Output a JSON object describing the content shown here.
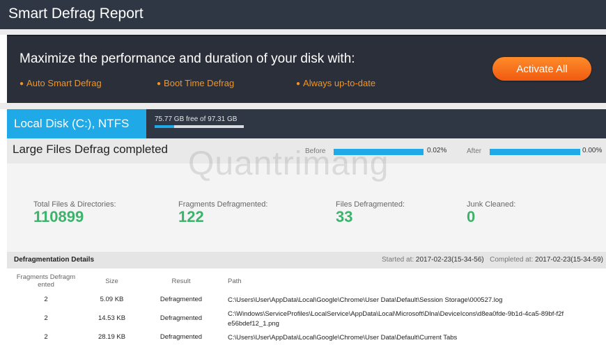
{
  "window": {
    "title": "Smart Defrag Report"
  },
  "promo": {
    "headline": "Maximize the performance and duration of your disk with:",
    "features": [
      "Auto Smart Defrag",
      "Boot Time Defrag",
      "Always up-to-date"
    ],
    "activate_label": "Activate All"
  },
  "disk": {
    "name": "Local Disk (C:), NTFS",
    "free_text": "75.77 GB free of 97.31 GB",
    "used_fraction": 0.22
  },
  "status": {
    "text": "Large Files Defrag completed",
    "before_label": "Before",
    "before_pct": "0.02%",
    "before_fraction": 0.0002,
    "after_label": "After",
    "after_pct": "0.00%",
    "after_fraction": 0.0
  },
  "stats": [
    {
      "label": "Total Files & Directories:",
      "value": "110899"
    },
    {
      "label": "Fragments Defragmented:",
      "value": "122"
    },
    {
      "label": "Files Defragmented:",
      "value": "33"
    },
    {
      "label": "Junk Cleaned:",
      "value": "0"
    }
  ],
  "watermark": "Quantrimang",
  "details": {
    "title": "Defragmentation Details",
    "started_label": "Started at:",
    "started_value": "2017-02-23(15-34-56)",
    "completed_label": "Completed at:",
    "completed_value": "2017-02-23(15-34-59)",
    "columns": [
      "Fragments Defragm ented",
      "Size",
      "Result",
      "Path"
    ],
    "rows": [
      {
        "fragments": "2",
        "size": "5.09 KB",
        "result": "Defragmented",
        "path": "C:\\Users\\User\\AppData\\Local\\Google\\Chrome\\User Data\\Default\\Session Storage\\000527.log"
      },
      {
        "fragments": "2",
        "size": "14.53 KB",
        "result": "Defragmented",
        "path": "C:\\Windows\\ServiceProfiles\\LocalService\\AppData\\Local\\Microsoft\\Dlna\\DeviceIcons\\d8ea0fde-9b1d-4ca5-89bf-f2f e56bdef12_1.png"
      },
      {
        "fragments": "2",
        "size": "28.19 KB",
        "result": "Defragmented",
        "path": "C:\\Users\\User\\AppData\\Local\\Google\\Chrome\\User Data\\Default\\Current Tabs"
      }
    ]
  },
  "colors": {
    "accent": "#1fa9e6",
    "orange": "#f7941d",
    "green": "#3bb36b",
    "dark": "#2f3744"
  }
}
